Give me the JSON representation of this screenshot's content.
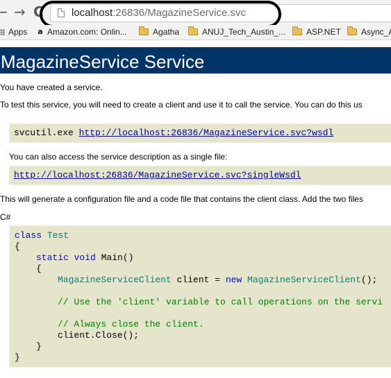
{
  "browser": {
    "back_glyph": "←",
    "forward_glyph": "→",
    "reload_glyph": "C",
    "url_host": "localhost",
    "url_rest": ":26836/MagazineService.svc",
    "bookmarks": [
      {
        "label": "Apps",
        "icon": "apps-grid-icon"
      },
      {
        "label": "Amazon.com: Onlin...",
        "icon": "amazon-icon"
      },
      {
        "label": "Agatha",
        "icon": "folder-icon"
      },
      {
        "label": "ANUJ_Tech_Austin_...",
        "icon": "folder-icon"
      },
      {
        "label": "ASP.NET",
        "icon": "folder-icon"
      },
      {
        "label": "Async_A",
        "icon": "folder-icon"
      }
    ]
  },
  "page": {
    "title": "MagazineService Service",
    "intro": "You have created a service.",
    "test_text": "To test this service, you will need to create a client and use it to call the service. You can do this us",
    "svcutil_cmd": "svcutil.exe ",
    "wsdl_url": "http://localhost:26836/MagazineService.svc?wsdl",
    "single_file_text": "You can also access the service description as a single file:",
    "single_wsdl_url": "http://localhost:26836/MagazineService.svc?singleWsdl",
    "generate_text": "This will generate a configuration file and a code file that contains the client class. Add the two files",
    "lang_label": "C#",
    "code": {
      "l1_kw": "class",
      "l1_cls": " Test",
      "l2": "{",
      "l3_kw": "static void",
      "l3_rest": " Main()",
      "l4": "{",
      "l5_cls1": "MagazineServiceClient",
      "l5_mid": " client = ",
      "l5_kw": "new",
      "l5_cls2": " MagazineServiceClient",
      "l5_end": "();",
      "l6": "// Use the 'client' variable to call operations on the servi",
      "l7": "// Always close the client.",
      "l8": "client.Close();",
      "l9": "}",
      "l10": "}"
    }
  },
  "colors": {
    "banner": "#003366",
    "code_bg": "#e5e5cc",
    "keyword": "#0000ff",
    "class_name": "#008080",
    "comment": "#008000",
    "link": "#000099"
  }
}
